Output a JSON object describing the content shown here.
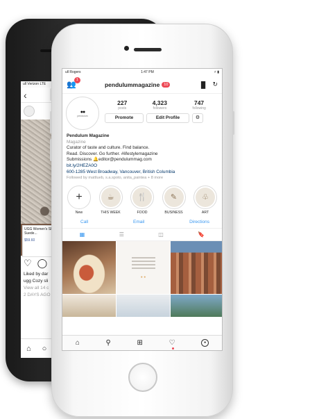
{
  "back_phone": {
    "status_left": "ull Verizon LTE",
    "back_icon": "chevron-left-icon",
    "product_title": "UGG Women's Slide Suede...",
    "product_price": "$59.60",
    "liked_by": "Liked by dar",
    "caption": "ugg Cozy sli",
    "comments": "View all 14 c",
    "time_ago": "2 DAYS AGO"
  },
  "status_bar": {
    "carrier": "ull Rogers",
    "time": "1:47 PM",
    "battery": "⚡ ▮"
  },
  "header": {
    "username": "pendulummagazine",
    "badge": "10",
    "notif_count": "1"
  },
  "profile": {
    "avatar_text": "pendulum",
    "stats": [
      {
        "num": "227",
        "label": "posts"
      },
      {
        "num": "4,323",
        "label": "followers"
      },
      {
        "num": "747",
        "label": "following"
      }
    ],
    "promote_label": "Promote",
    "edit_label": "Edit Profile",
    "options_glyph": "⚙"
  },
  "bio": {
    "name": "Pendulum Magazine",
    "category": "Magazine",
    "line1": "Curator of taste and culture. Find balance.",
    "line2": "Read. Discover. Go further. #lifestylemagazine",
    "line3": "Submissions 🔔editor@pendulummag.com",
    "link": "bit.ly/2HEZA0O",
    "address": "600-1285 West Broadway, Vancouver, British Columbia",
    "followed_by": "Followed by mattlueb, s.a.spoto, anita_paintea + 8 more"
  },
  "highlights": [
    {
      "label": "New",
      "glyph": "+"
    },
    {
      "label": "THIS WEEK",
      "glyph": "☕"
    },
    {
      "label": "FOOD",
      "glyph": "🍴"
    },
    {
      "label": "BUSINESS",
      "glyph": "✎"
    },
    {
      "label": "ART",
      "glyph": "♧"
    }
  ],
  "contact": {
    "call": "Call",
    "email": "Email",
    "directions": "Directions"
  },
  "tabbar_icons": [
    "home-icon",
    "search-icon",
    "add-icon",
    "heart-icon",
    "profile-icon"
  ]
}
